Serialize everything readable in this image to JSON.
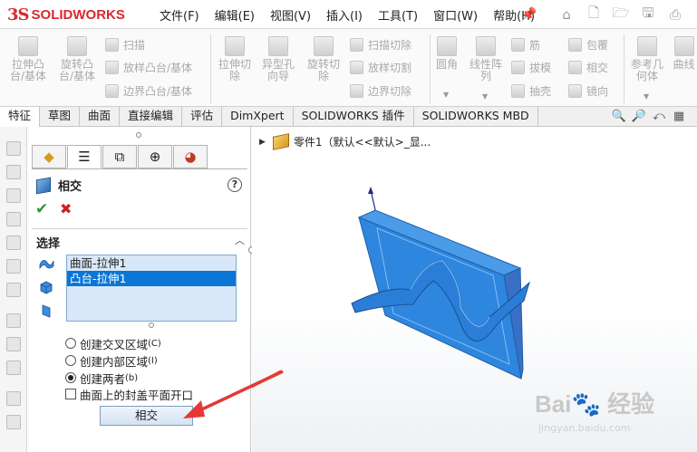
{
  "app": {
    "brand_prefix": "3S",
    "brand_name": "SOLIDWORKS"
  },
  "menu": [
    "文件(F)",
    "编辑(E)",
    "视图(V)",
    "插入(I)",
    "工具(T)",
    "窗口(W)",
    "帮助(H)"
  ],
  "ribbon": {
    "extrude_boss": "拉伸凸台/基体",
    "revolve_boss": "旋转凸台/基体",
    "sweep": "扫描",
    "loft_boss": "放样凸台/基体",
    "boundary_boss": "边界凸台/基体",
    "extrude_cut": "拉伸切除",
    "hole_wizard": "异型孔向导",
    "revolve_cut": "旋转切除",
    "sweep_cut": "扫描切除",
    "loft_cut": "放样切割",
    "boundary_cut": "边界切除",
    "fillet": "圆角",
    "linear_pattern": "线性阵列",
    "rib": "筋",
    "draft": "拔模",
    "shell": "抽壳",
    "wrap": "包覆",
    "intersect": "相交",
    "mirror": "镜向",
    "reference_geometry": "参考几何体",
    "curves": "曲线"
  },
  "tabs": [
    "特征",
    "草图",
    "曲面",
    "直接编辑",
    "评估",
    "DimXpert",
    "SOLIDWORKS 插件",
    "SOLIDWORKS MBD"
  ],
  "tree": {
    "part_label": "零件1（默认<<默认>_显..."
  },
  "property_manager": {
    "title": "相交",
    "help": "?",
    "ok_symbol": "✔",
    "cancel_symbol": "✖",
    "section_title": "选择",
    "selections": [
      "曲面-拉伸1",
      "凸台-拉伸1"
    ],
    "selected_index": 1,
    "options": {
      "create_intersect": "创建交叉区域",
      "create_intersect_key": "(C)",
      "create_internal": "创建内部区域",
      "create_internal_key": "(I)",
      "create_both": "创建两者",
      "create_both_key": "(b)",
      "cap_open": "曲面上的封盖平面开口",
      "selected_option": "create_both",
      "cap_checked": false
    },
    "apply_button": "相交"
  },
  "watermark": {
    "main": "Bai🐾 经验",
    "sub": "jingyan.baidu.com"
  },
  "colors": {
    "accent": "#0a76d6",
    "model": "#3a8de0",
    "arrow": "#e53935"
  }
}
